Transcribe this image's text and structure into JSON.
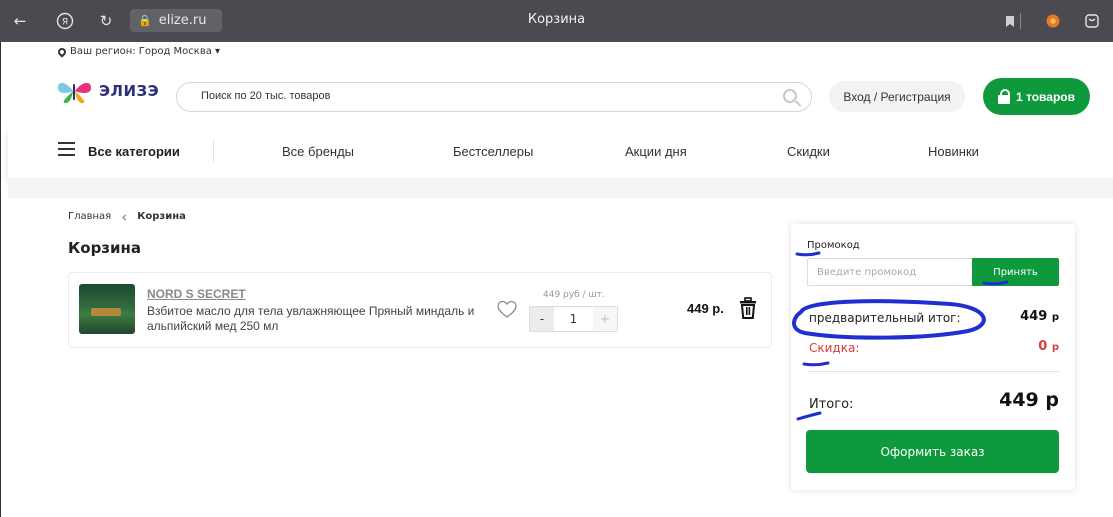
{
  "browser": {
    "url": "elize.ru",
    "title": "Корзина",
    "icons": [
      "back-arrow-icon",
      "yandex-icon",
      "reload-icon",
      "lock-icon",
      "bookmark-icon",
      "extension-icon",
      "profile-icon"
    ]
  },
  "region": {
    "label": "Ваш регион: Город Москва ▾"
  },
  "header": {
    "logo_text": "ЭЛИЗЭ",
    "search_placeholder": "Поиск по 20 тыс. товаров",
    "login_label": "Вход / Регистрация",
    "cart_label": "1 товаров"
  },
  "nav": {
    "all_categories": "Все категории",
    "items": [
      "Все бренды",
      "Бестселлеры",
      "Акции дня",
      "Скидки",
      "Новинки"
    ]
  },
  "breadcrumb": {
    "home": "Главная",
    "current": "Корзина"
  },
  "page_title": "Корзина",
  "cart_item": {
    "brand": "NORD S SECRET",
    "description": "Взбитое масло для тела увлажняющее Пряный миндаль и альпийский мед 250 мл",
    "unit_price": "449 руб / шт.",
    "qty_minus": "-",
    "quantity": "1",
    "qty_plus": "+",
    "total": "449 р."
  },
  "summary": {
    "promo_label": "Промокод",
    "promo_placeholder": "Введите промокод",
    "promo_button": "Принять",
    "subtotal_label": "предварительный итог:",
    "subtotal_value": "449",
    "subtotal_unit": "р",
    "discount_label": "Скидка:",
    "discount_value": "0",
    "discount_unit": "р",
    "total_label": "Итого:",
    "total_value": "449 р",
    "order_button": "Оформить заказ"
  },
  "colors": {
    "brand_green": "#0e9a3c",
    "discount_red": "#e13a3a",
    "annotation_blue": "#1f2fd0",
    "browser_bar": "#4a4a50"
  }
}
